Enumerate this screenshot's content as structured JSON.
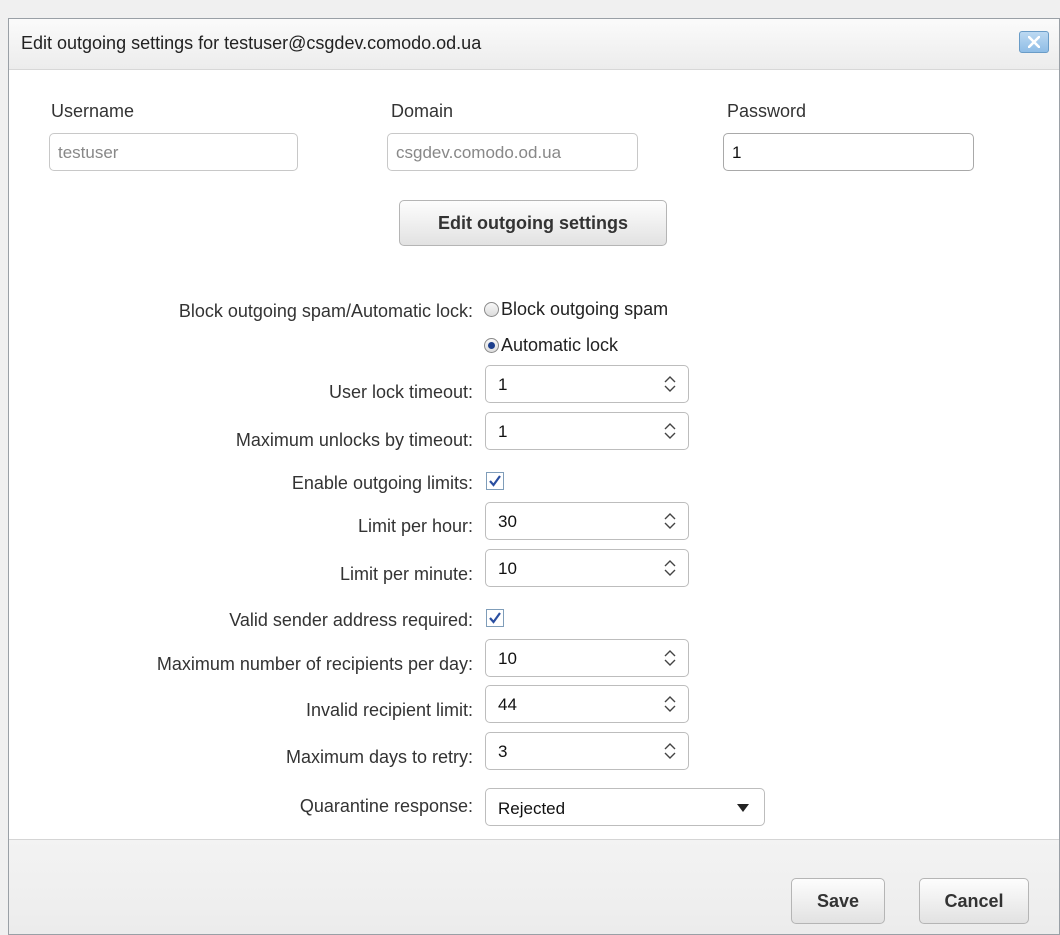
{
  "dialog": {
    "title": "Edit outgoing settings for testuser@csgdev.comodo.od.ua"
  },
  "account": {
    "username_label": "Username",
    "username_value": "testuser",
    "domain_label": "Domain",
    "domain_value": "csgdev.comodo.od.ua",
    "password_label": "Password",
    "password_value": "1"
  },
  "edit_button": "Edit outgoing settings",
  "settings": {
    "block_label": "Block outgoing spam/Automatic lock:",
    "radio_block": "Block outgoing spam",
    "radio_auto": "Automatic lock",
    "radio_selected": "Automatic lock",
    "user_lock_timeout_label": "User lock timeout:",
    "user_lock_timeout": "1",
    "max_unlocks_label": "Maximum unlocks by timeout:",
    "max_unlocks": "1",
    "enable_limits_label": "Enable outgoing limits:",
    "enable_limits_checked": true,
    "limit_hour_label": "Limit per hour:",
    "limit_hour": "30",
    "limit_minute_label": "Limit per minute:",
    "limit_minute": "10",
    "valid_sender_label": "Valid sender address required:",
    "valid_sender_checked": true,
    "max_recipients_label": "Maximum number of recipients per day:",
    "max_recipients": "10",
    "invalid_recipient_label": "Invalid recipient limit:",
    "invalid_recipient": "44",
    "max_days_retry_label": "Maximum days to retry:",
    "max_days_retry": "3",
    "quarantine_label": "Quarantine response:",
    "quarantine_value": "Rejected"
  },
  "footer": {
    "save": "Save",
    "cancel": "Cancel"
  },
  "icons": {
    "close": "close-icon",
    "spinner": "spinner-arrows-icon",
    "dropdown": "dropdown-arrow-icon",
    "check": "checkmark-icon"
  },
  "colors": {
    "close_button": "#8fbde6",
    "radio_selected": "#1c3e8c",
    "checkmark": "#2a4ea0"
  }
}
